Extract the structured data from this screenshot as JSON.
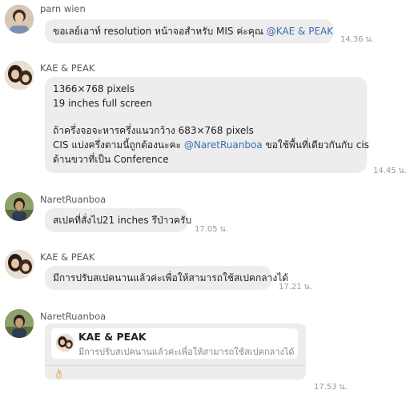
{
  "messages": [
    {
      "sender": "parn wien",
      "lines": [
        {
          "text": "ขอเลย์เอาท์ resolution หน้าจอสำหรับ MIS ค่ะคุณ ",
          "mention": "@KAE & PEAK"
        }
      ],
      "time": "14.36 น."
    },
    {
      "sender": "KAE & PEAK",
      "lines": [
        {
          "text": "1366×768 pixels"
        },
        {
          "text": "19 inches full screen"
        },
        {
          "text": ""
        },
        {
          "text": "ถ้าครึ่งจอจะหารครึ่งแนวกว้าง 683×768 pixels"
        },
        {
          "text": "CIS แบ่งครึ่งตามนี้ถูกต้องนะคะ ",
          "mention": "@NaretRuanboa",
          "after": " ขอใช้พื้นที่เดียวกันกับ cis"
        },
        {
          "text": "ด้านขวาที่เป็น Conference"
        }
      ],
      "time": "14.45 น."
    },
    {
      "sender": "NaretRuanboa",
      "lines": [
        {
          "text": "สเปคที่สั่งไป21 inches รึป่าวครับ"
        }
      ],
      "time": "17.05 น."
    },
    {
      "sender": "KAE & PEAK",
      "lines": [
        {
          "text": "มีการปรับสเปคนานแล้วค่ะเพื่อให้สามารถใช้สเปคกลางได้"
        }
      ],
      "time": "17.21 น."
    },
    {
      "sender": "NaretRuanboa",
      "reply": {
        "quoted_sender": "KAE & PEAK",
        "quoted_text": "มีการปรับสเปคนานแล้วค่ะเพื่อให้สามารถใช้สเปคกลางได้",
        "reaction": "👌🏻"
      },
      "time": "17.53 น."
    }
  ],
  "colors": {
    "bubble": "#ededed",
    "mention": "#3a6fb0",
    "time": "#9a9a9a"
  },
  "icons": {
    "avatar": "user-avatar",
    "reaction": "ok-hand-icon"
  }
}
